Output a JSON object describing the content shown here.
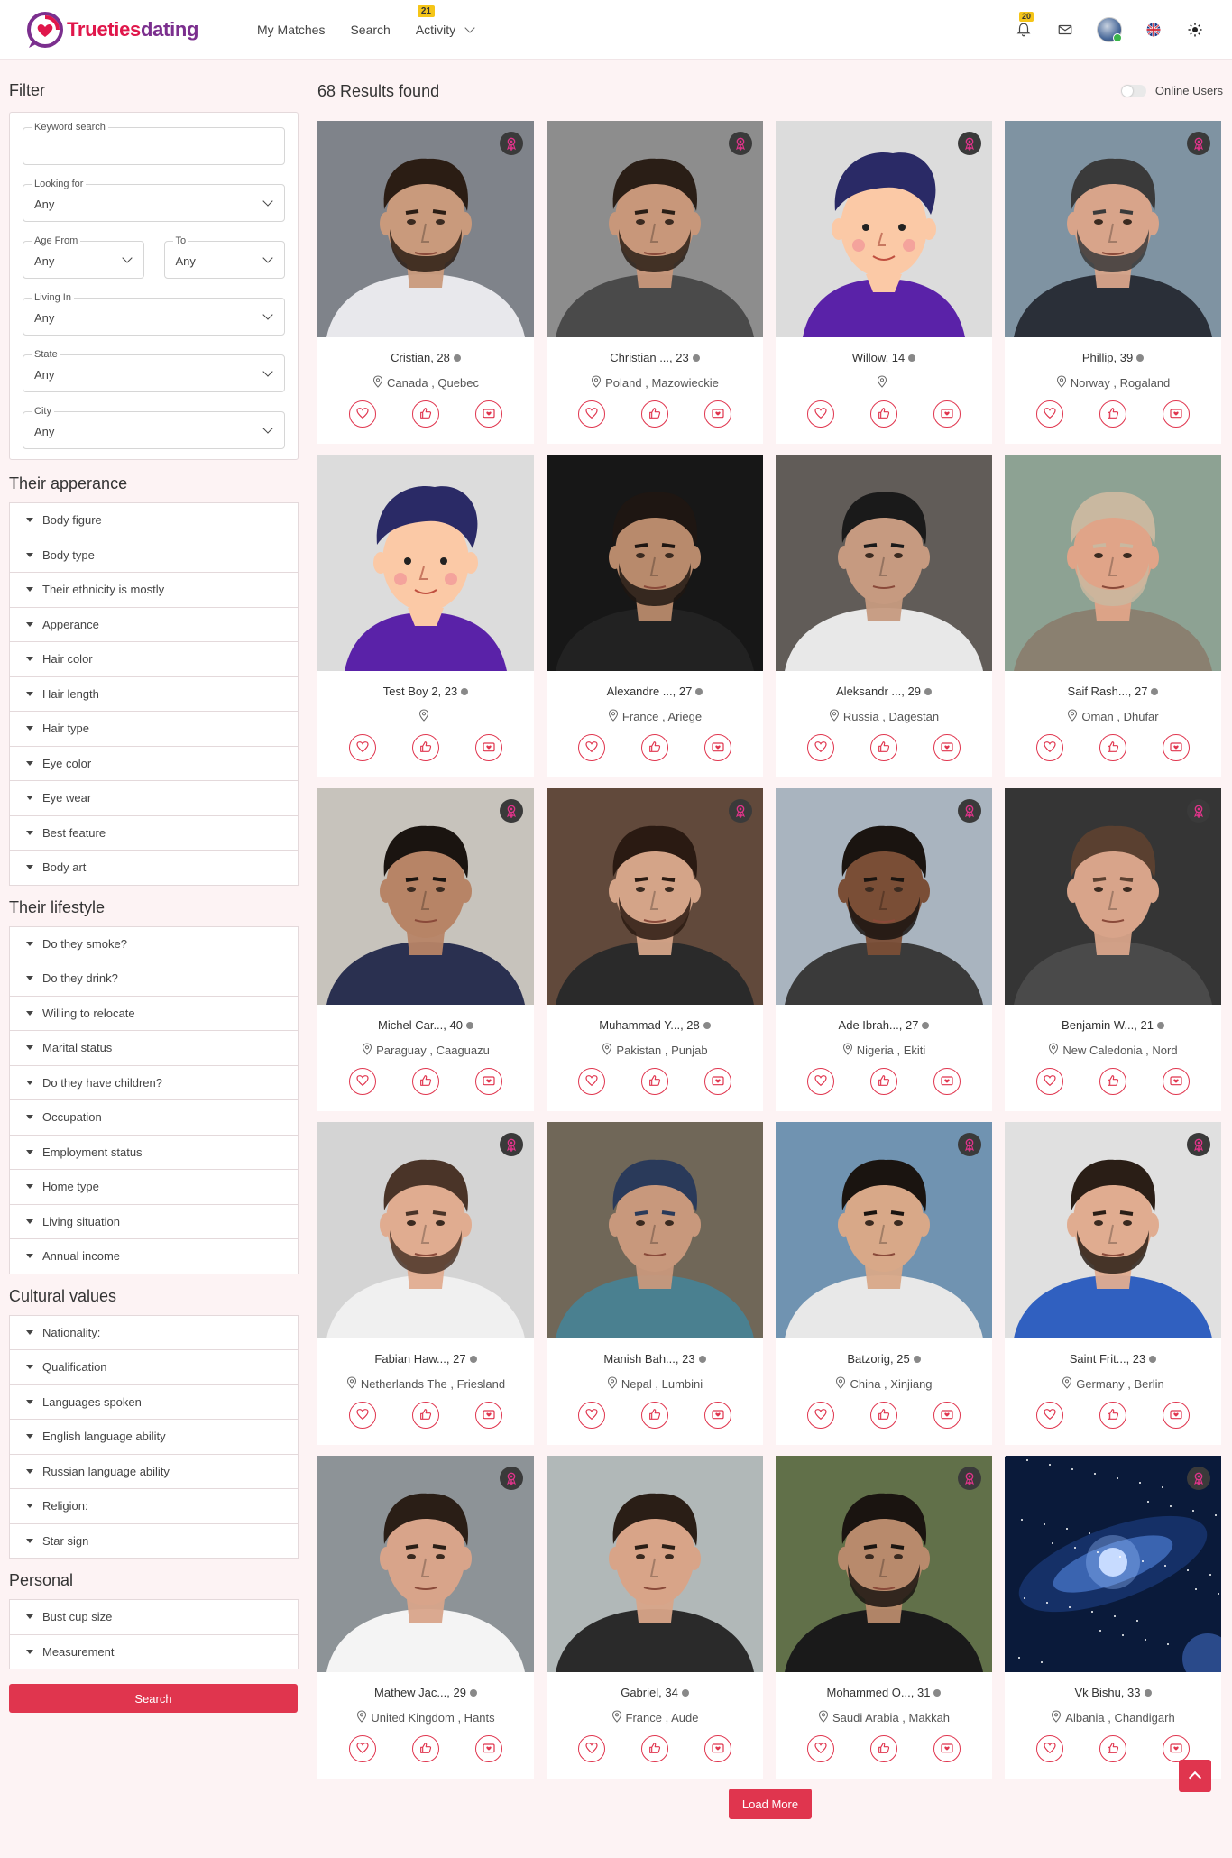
{
  "brand": {
    "name": "Truetiesdating",
    "prefix": "Trueties",
    "suffix": "dating"
  },
  "nav": {
    "my_matches": "My Matches",
    "search": "Search",
    "activity": "Activity",
    "activity_badge": "21"
  },
  "header": {
    "notifications_badge": "20"
  },
  "filter": {
    "title": "Filter",
    "keyword_label": "Keyword search",
    "keyword_value": "",
    "looking_for_label": "Looking for",
    "looking_for_value": "Any",
    "age_from_label": "Age From",
    "age_from_value": "Any",
    "age_to_label": "To",
    "age_to_value": "Any",
    "living_in_label": "Living In",
    "living_in_value": "Any",
    "state_label": "State",
    "state_value": "Any",
    "city_label": "City",
    "city_value": "Any"
  },
  "sections": {
    "appearance": {
      "title": "Their apperance",
      "items": [
        "Body figure",
        "Body type",
        "Their ethnicity is mostly",
        "Apperance",
        "Hair color",
        "Hair length",
        "Hair type",
        "Eye color",
        "Eye wear",
        "Best feature",
        "Body art"
      ]
    },
    "lifestyle": {
      "title": "Their lifestyle",
      "items": [
        "Do they smoke?",
        "Do they drink?",
        "Willing to relocate",
        "Marital status",
        "Do they have children?",
        "Occupation",
        "Employment status",
        "Home type",
        "Living situation",
        "Annual income"
      ]
    },
    "cultural": {
      "title": "Cultural values",
      "items": [
        "Nationality:",
        "Qualification",
        "Languages spoken",
        "English language ability",
        "Russian language ability",
        "Religion:",
        "Star sign"
      ]
    },
    "personal": {
      "title": "Personal",
      "items": [
        "Bust cup size",
        "Measurement"
      ]
    }
  },
  "search_button": "Search",
  "results": {
    "title": "68 Results found",
    "online_users": "Online Users",
    "load_more": "Load More"
  },
  "colors": {
    "accent": "#e0354e",
    "brand_pink": "#e0174b",
    "brand_purple": "#7b2f8e",
    "background": "#fdf3f4"
  },
  "profiles": [
    {
      "name": "Cristian, 28",
      "location": "Canada , Quebec",
      "badge": true,
      "photo": {
        "type": "photo",
        "bg": "#8a8f96",
        "skin": "#c99a7c",
        "hair": "#2b1d14",
        "shirt": "#e8e8ec",
        "beard": true
      }
    },
    {
      "name": "Christian ..., 23",
      "location": "Poland , Mazowieckie",
      "badge": true,
      "photo": {
        "type": "photo",
        "bg": "#9a9a9a",
        "skin": "#c8977a",
        "hair": "#2a1e16",
        "shirt": "#4a4a4a",
        "beard": true
      }
    },
    {
      "name": "Willow, 14",
      "location": "",
      "badge": true,
      "photo": {
        "type": "cartoon",
        "bg": "#dcdcdc",
        "skin": "#fbc9a6",
        "hair": "#2a2a66",
        "shirt": "#5a22a8",
        "beard": false
      }
    },
    {
      "name": "Phillip, 39",
      "location": "Norway , Rogaland",
      "badge": true,
      "photo": {
        "type": "photo",
        "bg": "#8aa0b0",
        "skin": "#d8a48a",
        "hair": "#3a3a3a",
        "shirt": "#2a2f38",
        "beard": true
      }
    },
    {
      "name": "Test Boy 2, 23",
      "location": "",
      "badge": false,
      "photo": {
        "type": "cartoon",
        "bg": "#dcdcdc",
        "skin": "#fbc9a6",
        "hair": "#2a2a66",
        "shirt": "#5a22a8",
        "beard": false
      }
    },
    {
      "name": "Alexandre ..., 27",
      "location": "France , Ariege",
      "badge": false,
      "photo": {
        "type": "photo",
        "bg": "#1a1a1a",
        "skin": "#b88a6c",
        "hair": "#1e1612",
        "shirt": "#222",
        "beard": true
      }
    },
    {
      "name": "Aleksandr ..., 29",
      "location": "Russia , Dagestan",
      "badge": false,
      "photo": {
        "type": "photo",
        "bg": "#6a6460",
        "skin": "#c69a80",
        "hair": "#1a1a1a",
        "shirt": "#e8e8e8",
        "beard": false
      }
    },
    {
      "name": "Saif Rash..., 27",
      "location": "Oman , Dhufar",
      "badge": false,
      "photo": {
        "type": "photo",
        "bg": "#9ab0a0",
        "skin": "#e0a488",
        "hair": "#c9b8a0",
        "shirt": "#8a8070",
        "beard": true
      }
    },
    {
      "name": "Michel Car..., 40",
      "location": "Paraguay , Caaguazu",
      "badge": true,
      "photo": {
        "type": "photo",
        "bg": "#d8d4cc",
        "skin": "#b78466",
        "hair": "#1a1410",
        "shirt": "#2a3050",
        "beard": false
      }
    },
    {
      "name": "Muhammad Y..., 28",
      "location": "Pakistan , Punjab",
      "badge": true,
      "photo": {
        "type": "photo",
        "bg": "#6a5040",
        "skin": "#d4a488",
        "hair": "#2a1a12",
        "shirt": "#2a2a2a",
        "beard": true
      }
    },
    {
      "name": "Ade Ibrah..., 27",
      "location": "Nigeria , Ekiti",
      "badge": true,
      "photo": {
        "type": "photo",
        "bg": "#b8c4d0",
        "skin": "#7a4e36",
        "hair": "#1a1410",
        "shirt": "#3a3a3a",
        "beard": true
      }
    },
    {
      "name": "Benjamin W..., 21",
      "location": "New Caledonia , Nord",
      "badge": true,
      "photo": {
        "type": "photo",
        "bg": "#3a3a3a",
        "skin": "#d8a48a",
        "hair": "#5a4030",
        "shirt": "#4a4a4a",
        "beard": false
      }
    },
    {
      "name": "Fabian Haw..., 27",
      "location": "Netherlands The , Friesland",
      "badge": true,
      "photo": {
        "type": "photo",
        "bg": "#e6e6e6",
        "skin": "#e0ac90",
        "hair": "#4a3428",
        "shirt": "#f0f0f0",
        "beard": true
      }
    },
    {
      "name": "Manish Bah..., 23",
      "location": "Nepal , Lumbini",
      "badge": false,
      "photo": {
        "type": "photo",
        "bg": "#7a7060",
        "skin": "#c8987c",
        "hair": "#2a3a5a",
        "shirt": "#4a8090",
        "beard": false
      }
    },
    {
      "name": "Batzorig, 25",
      "location": "China , Xinjiang",
      "badge": true,
      "photo": {
        "type": "photo",
        "bg": "#7aa0c0",
        "skin": "#d8a888",
        "hair": "#1a1410",
        "shirt": "#e8e8e8",
        "beard": false
      }
    },
    {
      "name": "Saint Frit..., 23",
      "location": "Germany , Berlin",
      "badge": true,
      "photo": {
        "type": "photo",
        "bg": "#f4f4f4",
        "skin": "#e0ac90",
        "hair": "#2a1e16",
        "shirt": "#3060c0",
        "beard": true
      }
    },
    {
      "name": "Mathew Jac..., 29",
      "location": "United Kingdom , Hants",
      "badge": true,
      "photo": {
        "type": "photo",
        "bg": "#9aa0a4",
        "skin": "#d8a48a",
        "hair": "#2a1e16",
        "shirt": "#f4f4f4",
        "beard": false
      }
    },
    {
      "name": "Gabriel, 34",
      "location": "France , Aude",
      "badge": false,
      "photo": {
        "type": "photo",
        "bg": "#c0c8c8",
        "skin": "#d8a488",
        "hair": "#2a1e16",
        "shirt": "#2a2a2a",
        "beard": false
      }
    },
    {
      "name": "Mohammed O..., 31",
      "location": "Saudi Arabia , Makkah",
      "badge": true,
      "photo": {
        "type": "photo",
        "bg": "#6a7a50",
        "skin": "#b88a6c",
        "hair": "#1a1410",
        "shirt": "#1a1a1a",
        "beard": true
      }
    },
    {
      "name": "Vk Bishu, 33",
      "location": "Albania , Chandigarh",
      "badge": true,
      "photo": {
        "type": "space",
        "bg": "#0a1a3a",
        "skin": "#ffffff",
        "hair": "#6ab0ff",
        "shirt": "#0a1a3a",
        "beard": false
      }
    }
  ]
}
